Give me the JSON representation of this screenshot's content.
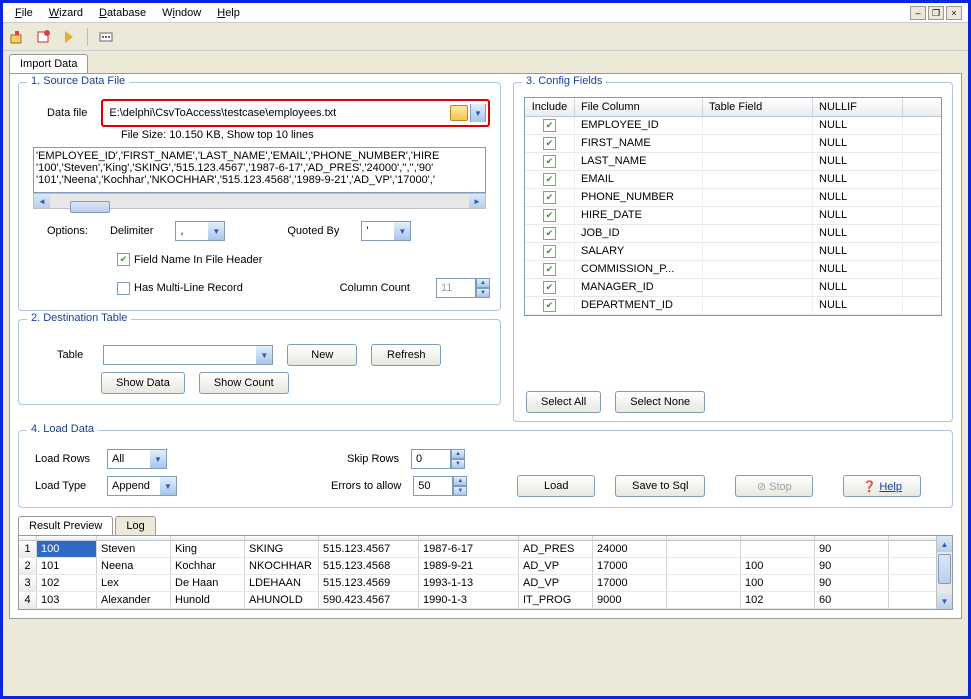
{
  "menu": {
    "file": "File",
    "wizard": "Wizard",
    "database": "Database",
    "window": "Window",
    "help": "Help"
  },
  "tabs": {
    "import": "Import Data"
  },
  "source": {
    "title": "1. Source Data File",
    "datafile_label": "Data file",
    "datafile_value": "E:\\delphi\\CsvToAccess\\testcase\\employees.txt",
    "filesize": "File Size: 10.150 KB,   Show top 10 lines",
    "preview_l1": "'EMPLOYEE_ID','FIRST_NAME','LAST_NAME','EMAIL','PHONE_NUMBER','HIRE",
    "preview_l2": "'100','Steven','King','SKING','515.123.4567','1987-6-17','AD_PRES','24000','','','90'",
    "preview_l3": "'101','Neena','Kochhar','NKOCHHAR','515.123.4568','1989-9-21','AD_VP','17000','",
    "options": "Options:",
    "delimiter": "Delimiter",
    "delimiter_val": ",",
    "quoted": "Quoted By",
    "quoted_val": "'",
    "fieldheader": "Field Name In File Header",
    "multiline": "Has Multi-Line Record",
    "colcount": "Column Count",
    "colcount_val": "11"
  },
  "dest": {
    "title": "2. Destination Table",
    "table": "Table",
    "new": "New",
    "refresh": "Refresh",
    "showdata": "Show Data",
    "showcount": "Show Count"
  },
  "config": {
    "title": "3. Config Fields",
    "h_include": "Include",
    "h_filecol": "File Column",
    "h_tablefield": "Table Field",
    "h_nullif": "NULLIF",
    "rows": [
      {
        "fc": "EMPLOYEE_ID",
        "nf": "NULL"
      },
      {
        "fc": "FIRST_NAME",
        "nf": "NULL"
      },
      {
        "fc": "LAST_NAME",
        "nf": "NULL"
      },
      {
        "fc": "EMAIL",
        "nf": "NULL"
      },
      {
        "fc": "PHONE_NUMBER",
        "nf": "NULL"
      },
      {
        "fc": "HIRE_DATE",
        "nf": "NULL"
      },
      {
        "fc": "JOB_ID",
        "nf": "NULL"
      },
      {
        "fc": "SALARY",
        "nf": "NULL"
      },
      {
        "fc": "COMMISSION_P...",
        "nf": "NULL"
      },
      {
        "fc": "MANAGER_ID",
        "nf": "NULL"
      },
      {
        "fc": "DEPARTMENT_ID",
        "nf": "NULL"
      }
    ],
    "selectall": "Select All",
    "selectnone": "Select None"
  },
  "load": {
    "title": "4. Load Data",
    "loadrows": "Load Rows",
    "loadrows_val": "All",
    "skiprows": "Skip Rows",
    "skiprows_val": "0",
    "loadtype": "Load Type",
    "loadtype_val": "Append",
    "errors": "Errors to allow",
    "errors_val": "50",
    "load": "Load",
    "save": "Save to Sql",
    "stop": "Stop",
    "help": "Help"
  },
  "result": {
    "tab_preview": "Result Preview",
    "tab_log": "Log",
    "rows": [
      {
        "n": "1",
        "id": "100",
        "fn": "Steven",
        "ln": "King",
        "em": "SKING",
        "ph": "515.123.4567",
        "hd": "1987-6-17",
        "job": "AD_PRES",
        "sal": "24000",
        "com": "",
        "mgr": "",
        "dep": "90"
      },
      {
        "n": "2",
        "id": "101",
        "fn": "Neena",
        "ln": "Kochhar",
        "em": "NKOCHHAR",
        "ph": "515.123.4568",
        "hd": "1989-9-21",
        "job": "AD_VP",
        "sal": "17000",
        "com": "",
        "mgr": "100",
        "dep": "90"
      },
      {
        "n": "3",
        "id": "102",
        "fn": "Lex",
        "ln": "De Haan",
        "em": "LDEHAAN",
        "ph": "515.123.4569",
        "hd": "1993-1-13",
        "job": "AD_VP",
        "sal": "17000",
        "com": "",
        "mgr": "100",
        "dep": "90"
      },
      {
        "n": "4",
        "id": "103",
        "fn": "Alexander",
        "ln": "Hunold",
        "em": "AHUNOLD",
        "ph": "590.423.4567",
        "hd": "1990-1-3",
        "job": "IT_PROG",
        "sal": "9000",
        "com": "",
        "mgr": "102",
        "dep": "60"
      }
    ]
  }
}
